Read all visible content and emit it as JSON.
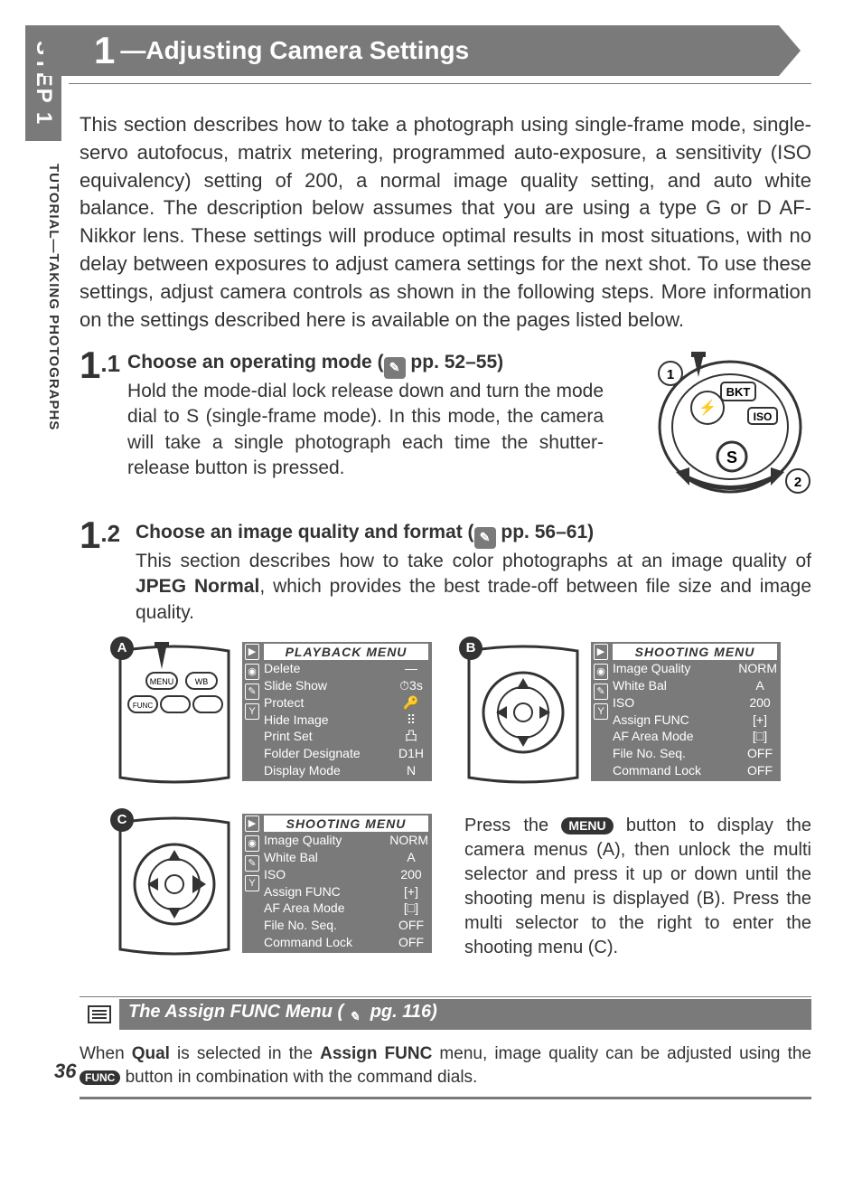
{
  "header": {
    "section_number": "1",
    "title": "Adjusting Camera Settings"
  },
  "side": {
    "step": "STEP 1",
    "label": "TUTORIAL—TAKING PHOTOGRAPHS"
  },
  "intro": "This section describes how to take a photograph using single-frame mode, single-servo autofocus, matrix metering, programmed auto-exposure, a sensitivity (ISO equivalency) setting of 200, a normal image quality setting, and auto white balance. The description below assumes that you are using a type G or D AF-Nikkor lens. These settings will produce optimal results in most situations, with no delay between exposures to adjust camera settings for the next shot. To use these settings, adjust camera controls as shown in the following steps. More information on the settings described here is available on the pages listed below.",
  "steps": {
    "s1": {
      "num_big": "1",
      "num_small": ".1",
      "heading_before": "Choose an operating mode (",
      "heading_after": " pp. 52–55)",
      "body": "Hold the mode-dial lock release down and turn the mode dial to S (single-frame mode). In this mode, the camera will take a single photograph each time the shutter-release button is pressed."
    },
    "s2": {
      "num_big": "1",
      "num_small": ".2",
      "heading_before": "Choose an image quality and format (",
      "heading_after": " pp. 56–61)",
      "body_before": "This section describes how to take color photographs at an image quality of ",
      "body_bold": "JPEG Normal",
      "body_after": ", which provides the best trade-off between file size and image quality."
    }
  },
  "figures": {
    "a": {
      "label": "A"
    },
    "b": {
      "label": "B"
    },
    "c": {
      "label": "C"
    }
  },
  "menus": {
    "playback": {
      "title": "PLAYBACK MENU",
      "items": [
        {
          "label": "Delete",
          "val": "—"
        },
        {
          "label": "Slide Show",
          "val": "⏱3s"
        },
        {
          "label": "Protect",
          "val": "🔑"
        },
        {
          "label": "Hide Image",
          "val": "⠿"
        },
        {
          "label": "Print Set",
          "val": "凸"
        },
        {
          "label": "Folder Designate",
          "val": "D1H"
        },
        {
          "label": "Display Mode",
          "val": "N"
        }
      ]
    },
    "shooting": {
      "title": "SHOOTING MENU",
      "items": [
        {
          "label": "Image Quality",
          "val": "NORM"
        },
        {
          "label": "White Bal",
          "val": "A"
        },
        {
          "label": "ISO",
          "val": "200"
        },
        {
          "label": "Assign FUNC",
          "val": "[+]"
        },
        {
          "label": "AF Area Mode",
          "val": "[□]"
        },
        {
          "label": "File No. Seq.",
          "val": "OFF"
        },
        {
          "label": "Command Lock",
          "val": "OFF"
        }
      ]
    }
  },
  "dial_labels": {
    "one": "1",
    "two": "2",
    "bkt": "BKT",
    "iso": "ISO",
    "bolt": "⚡",
    "s": "S"
  },
  "instruction": {
    "t1": "Press the ",
    "menu": "MENU",
    "t2": " button to display the camera menus (A), then unlock the multi selector and press it up or down until the shooting menu is displayed (B). Press the multi selector to the right to enter the shooting menu (C)."
  },
  "tip": {
    "title_before": "The Assign FUNC Menu (",
    "title_after": " pg. 116)",
    "body_before": "When ",
    "qual": "Qual",
    "body_mid": " is selected in the ",
    "assign": "Assign FUNC",
    "body_mid2": " menu, image quality can be adjusted using the ",
    "func_label": "FUNC",
    "body_after": " button in combination with the command dials."
  },
  "page_number": "36"
}
